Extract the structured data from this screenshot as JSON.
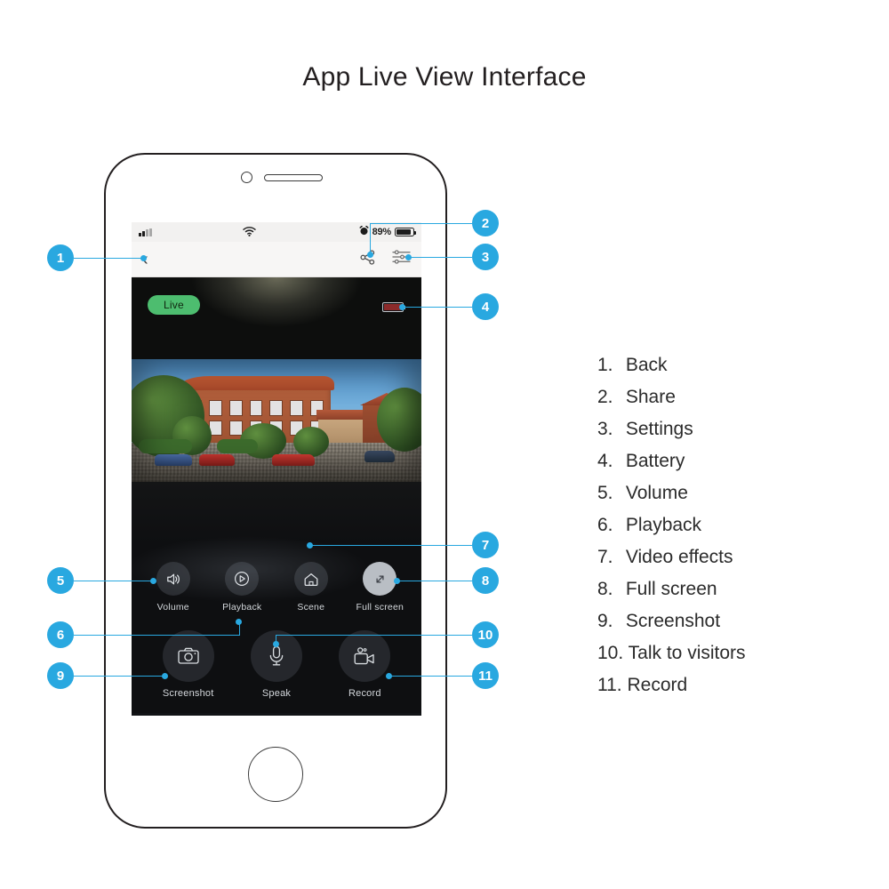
{
  "page": {
    "title": "App Live View Interface"
  },
  "phone": {
    "status_bar": {
      "signal_icon": "signal-bars-icon",
      "wifi_icon": "wifi-icon",
      "alarm_icon": "alarm-clock-icon",
      "battery_percent": "89%",
      "battery_icon": "battery-icon"
    },
    "nav_bar": {
      "back_icon": "chevron-left-icon",
      "back_glyph": "‹",
      "share_icon": "share-icon",
      "settings_icon": "sliders-settings-icon"
    },
    "video": {
      "live_badge": "Live",
      "camera_battery_icon": "camera-battery-low-icon"
    },
    "controls_row1": [
      {
        "label": "Volume",
        "icon": "volume-speaker-icon"
      },
      {
        "label": "Playback",
        "icon": "play-circle-icon"
      },
      {
        "label": "Scene",
        "icon": "home-house-icon"
      },
      {
        "label": "Full screen",
        "icon": "fullscreen-expand-icon"
      }
    ],
    "controls_row2": [
      {
        "label": "Screenshot",
        "icon": "camera-icon"
      },
      {
        "label": "Speak",
        "icon": "microphone-icon"
      },
      {
        "label": "Record",
        "icon": "video-camera-icon"
      }
    ]
  },
  "callouts": [
    {
      "n": "1"
    },
    {
      "n": "2"
    },
    {
      "n": "3"
    },
    {
      "n": "4"
    },
    {
      "n": "5"
    },
    {
      "n": "6"
    },
    {
      "n": "7"
    },
    {
      "n": "8"
    },
    {
      "n": "9"
    },
    {
      "n": "10"
    },
    {
      "n": "11"
    }
  ],
  "legend": [
    {
      "num": "1.",
      "label": "Back"
    },
    {
      "num": "2.",
      "label": "Share"
    },
    {
      "num": "3.",
      "label": "Settings"
    },
    {
      "num": "4.",
      "label": "Battery"
    },
    {
      "num": "5.",
      "label": "Volume"
    },
    {
      "num": "6.",
      "label": "Playback"
    },
    {
      "num": "7.",
      "label": "Video effects"
    },
    {
      "num": "8.",
      "label": "Full screen"
    },
    {
      "num": "9.",
      "label": "Screenshot"
    },
    {
      "num": "10.",
      "label": "Talk to visitors"
    },
    {
      "num": "11.",
      "label": "Record"
    }
  ],
  "colors": {
    "accent": "#29a8e0",
    "live_green": "#4dbd6f",
    "text": "#2b2b2b"
  }
}
